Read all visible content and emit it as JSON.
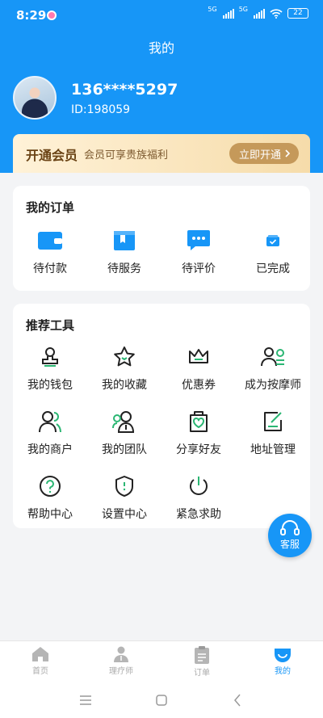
{
  "status_bar": {
    "time": "8:29",
    "signal_1": "5G",
    "signal_2": "5G",
    "battery": "22"
  },
  "page_title": "我的",
  "user": {
    "phone": "136****5297",
    "id": "ID:198059"
  },
  "vip": {
    "title": "开通会员",
    "desc": "会员可享贵族福利",
    "button": "立即开通"
  },
  "orders": {
    "title": "我的订单",
    "items": [
      {
        "label": "待付款",
        "icon": "wallet-icon"
      },
      {
        "label": "待服务",
        "icon": "bookmark-icon"
      },
      {
        "label": "待评价",
        "icon": "chat-icon"
      },
      {
        "label": "已完成",
        "icon": "check-box-icon"
      }
    ]
  },
  "tools": {
    "title": "推荐工具",
    "items": [
      {
        "label": "我的钱包",
        "icon": "stamp-icon"
      },
      {
        "label": "我的收藏",
        "icon": "star-icon"
      },
      {
        "label": "优惠券",
        "icon": "crown-icon"
      },
      {
        "label": "成为按摩师",
        "icon": "user-card-icon"
      },
      {
        "label": "我的商户",
        "icon": "users-icon"
      },
      {
        "label": "我的团队",
        "icon": "team-icon"
      },
      {
        "label": "分享好友",
        "icon": "share-heart-icon"
      },
      {
        "label": "地址管理",
        "icon": "edit-icon"
      },
      {
        "label": "帮助中心",
        "icon": "question-icon"
      },
      {
        "label": "设置中心",
        "icon": "shield-icon"
      },
      {
        "label": "紧急求助",
        "icon": "power-icon"
      }
    ]
  },
  "service": {
    "label": "客服"
  },
  "tabs": [
    {
      "label": "首页",
      "icon": "home-icon"
    },
    {
      "label": "理疗师",
      "icon": "therapist-icon"
    },
    {
      "label": "订单",
      "icon": "clipboard-icon"
    },
    {
      "label": "我的",
      "icon": "profile-icon"
    }
  ],
  "colors": {
    "primary": "#1796f7",
    "accent_green": "#2bb673",
    "vip_gold": "#c5995a"
  }
}
